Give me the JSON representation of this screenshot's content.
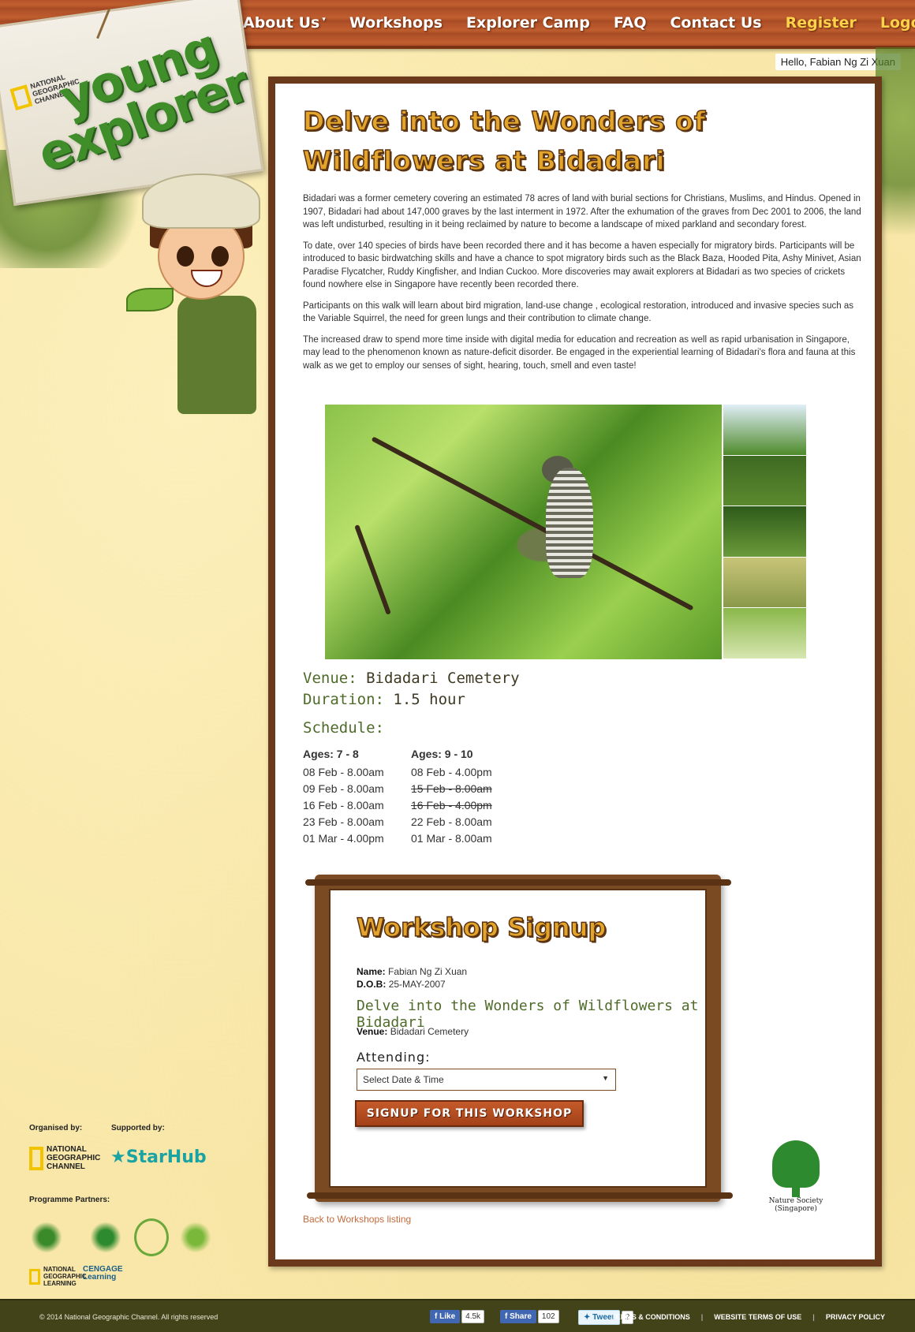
{
  "nav": {
    "items": [
      {
        "label": "About Us",
        "caret": "▾"
      },
      {
        "label": "Workshops"
      },
      {
        "label": "Explorer Camp"
      },
      {
        "label": "FAQ"
      },
      {
        "label": "Contact Us"
      },
      {
        "label": "Register"
      },
      {
        "label": "Logout",
        "caret": "▾"
      }
    ],
    "highlight_color": "#ffd24a"
  },
  "greeting": "Hello, Fabian Ng Zi Xuan",
  "logo": {
    "brand_small": "NATIONAL GEOGRAPHIC CHANNEL",
    "brand_large_1": "young",
    "brand_large_2": "explorer"
  },
  "workshop": {
    "title_line1": "Delve into the Wonders of",
    "title_line2": "Wildflowers at Bidadari",
    "paragraphs": [
      "Bidadari was a former cemetery covering an estimated 78 acres of land with burial sections for Christians, Muslims, and Hindus. Opened in 1907, Bidadari had about 147,000 graves by the last interment in 1972. After the exhumation of the graves from Dec 2001 to 2006, the land was left undisturbed, resulting in it being reclaimed by nature to become a landscape of mixed parkland and secondary forest.",
      "To date, over 140 species of birds have been recorded there and it has become a haven especially for migratory birds. Participants will be introduced to basic birdwatching skills and have a chance to spot migratory birds such as the Black Baza, Hooded Pita, Ashy Minivet, Asian Paradise Flycatcher, Ruddy Kingfisher, and Indian Cuckoo. More discoveries may await explorers at Bidadari as two species of crickets found nowhere else in Singapore have recently been recorded there.",
      "Participants on this walk will learn about bird migration, land-use change , ecological restoration, introduced and invasive species such as the Variable Squirrel, the need for green lungs and their contribution to climate change.",
      "The increased draw to spend more time inside with digital media for education and recreation as well as rapid urbanisation in Singapore, may lead to the phenomenon known as nature-deficit disorder. Be engaged in the experiential learning of Bidadari's flora and fauna at this walk as we get to employ our senses of sight, hearing, touch, smell and even taste!"
    ],
    "venue_label": "Venue:",
    "venue": "Bidadari Cemetery",
    "duration_label": "Duration:",
    "duration": "1.5 hour",
    "schedule_label": "Schedule:",
    "schedule": [
      {
        "heading": "Ages: 7 - 8",
        "slots": [
          {
            "text": "08 Feb - 8.00am",
            "cancelled": false
          },
          {
            "text": "09 Feb - 8.00am",
            "cancelled": false
          },
          {
            "text": "16 Feb - 8.00am",
            "cancelled": false
          },
          {
            "text": "23 Feb - 8.00am",
            "cancelled": false
          },
          {
            "text": "01 Mar - 4.00pm",
            "cancelled": false
          }
        ]
      },
      {
        "heading": "Ages: 9 - 10",
        "slots": [
          {
            "text": "08 Feb - 4.00pm",
            "cancelled": false
          },
          {
            "text": "15 Feb - 8.00am",
            "cancelled": true
          },
          {
            "text": "16 Feb - 4.00pm",
            "cancelled": true
          },
          {
            "text": "22 Feb - 8.00am",
            "cancelled": false
          },
          {
            "text": "01 Mar - 8.00am",
            "cancelled": false
          }
        ]
      }
    ]
  },
  "signup": {
    "title": "Workshop Signup",
    "name_label": "Name:",
    "name": "Fabian Ng Zi Xuan",
    "dob_label": "D.O.B:",
    "dob": "25-MAY-2007",
    "workshop_title": "Delve into the Wonders of Wildflowers at Bidadari",
    "venue_label": "Venue:",
    "venue": "Bidadari Cemetery",
    "attending_label": "Attending:",
    "select_value": "Select Date & Time",
    "button_label": "SIGNUP FOR THIS WORKSHOP"
  },
  "back_link": "Back to Workshops listing",
  "partner_logo": {
    "name": "Nature Society (Singapore)"
  },
  "sidebar_footer": {
    "organised_by": "Organised by:",
    "supported_by": "Supported by:",
    "programme_partners": "Programme Partners:",
    "ngc": "NATIONAL GEOGRAPHIC CHANNEL",
    "starhub": "StarHub",
    "ngl": "NATIONAL GEOGRAPHIC LEARNING",
    "cengage": "CENGAGE Learning"
  },
  "footer": {
    "copyright": "© 2014 National Geographic Channel. All rights reserved",
    "like": "Like",
    "like_count": "4.5k",
    "share": "Share",
    "share_count": "102",
    "tweet": "Tweet",
    "tweet_count": "2",
    "links": [
      "TERMS & CONDITIONS",
      "WEBSITE TERMS OF USE",
      "PRIVACY POLICY"
    ]
  }
}
